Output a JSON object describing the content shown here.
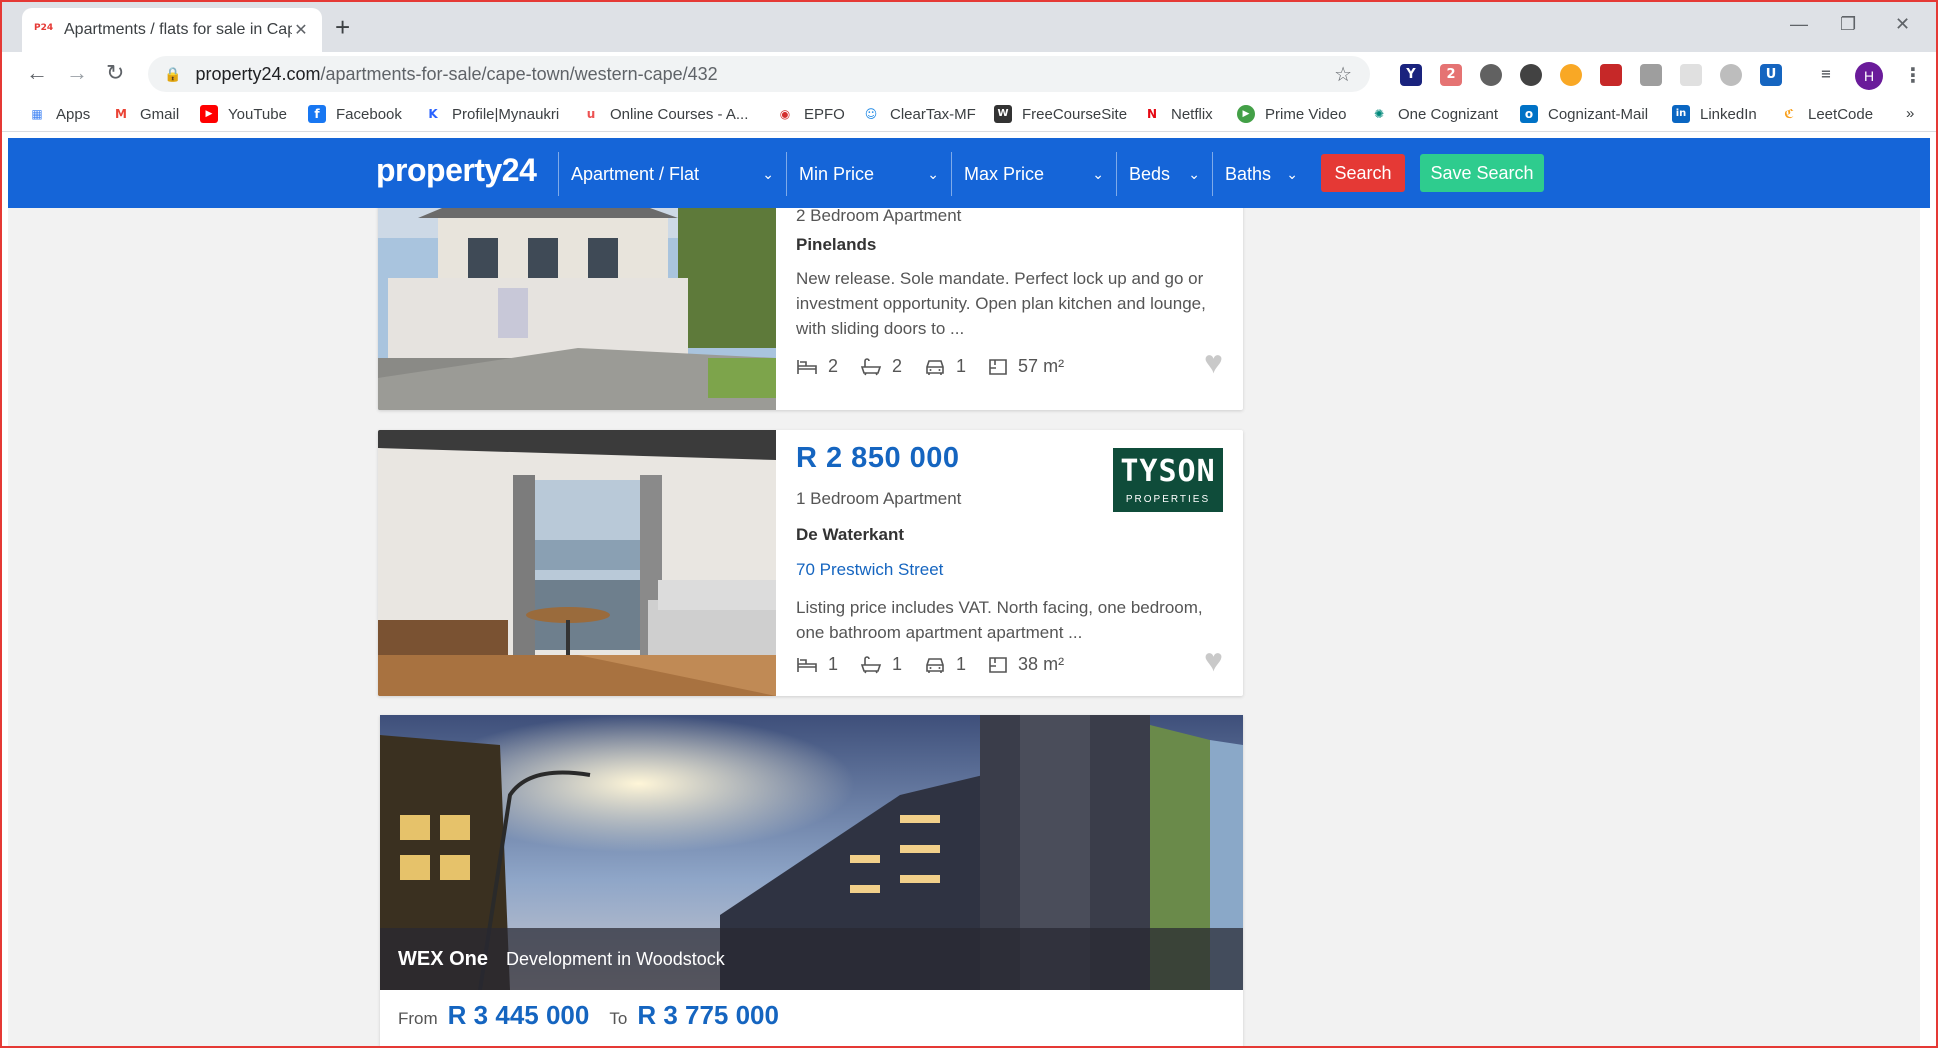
{
  "browser": {
    "tab_title": "Apartments / flats for sale in Cap",
    "favicon_text": "P24",
    "url_host": "property24.com",
    "url_path": "/apartments-for-sale/cape-town/western-cape/432",
    "profile_initial": "H",
    "extension_badge": "2"
  },
  "bookmarks": [
    {
      "label": "Apps",
      "icon": "apps-grid-icon",
      "color": "#4285f4"
    },
    {
      "label": "Gmail",
      "icon": "gmail-icon",
      "color": "#ea4335"
    },
    {
      "label": "YouTube",
      "icon": "youtube-icon",
      "color": "#ff0000"
    },
    {
      "label": "Facebook",
      "icon": "facebook-icon",
      "color": "#1877f2"
    },
    {
      "label": "Profile|Mynaukri",
      "icon": "naukri-icon",
      "color": "#2962ff"
    },
    {
      "label": "Online Courses - A...",
      "icon": "udemy-icon",
      "color": "#ec5252"
    },
    {
      "label": "EPFO",
      "icon": "epfo-icon",
      "color": "#d32f2f"
    },
    {
      "label": "ClearTax-MF",
      "icon": "cleartax-icon",
      "color": "#1e88e5"
    },
    {
      "label": "FreeCourseSite",
      "icon": "freecoursesite-icon",
      "color": "#333333"
    },
    {
      "label": "Netflix",
      "icon": "netflix-icon",
      "color": "#e50914"
    },
    {
      "label": "Prime Video",
      "icon": "prime-video-icon",
      "color": "#43a047"
    },
    {
      "label": "One Cognizant",
      "icon": "one-cognizant-icon",
      "color": "#00897b"
    },
    {
      "label": "Cognizant-Mail",
      "icon": "outlook-icon",
      "color": "#0072c6"
    },
    {
      "label": "LinkedIn",
      "icon": "linkedin-icon",
      "color": "#0a66c2"
    },
    {
      "label": "LeetCode",
      "icon": "leetcode-icon",
      "color": "#222222"
    }
  ],
  "header": {
    "logo": "property24",
    "filters": [
      "Apartment / Flat",
      "Min Price",
      "Max Price",
      "Beds",
      "Baths"
    ],
    "search_label": "Search",
    "save_search_label": "Save Search",
    "colors": {
      "brand": "#1565d8",
      "search": "#e53935",
      "save": "#2ecc8e"
    }
  },
  "listings": [
    {
      "type": "2 Bedroom Apartment",
      "suburb": "Pinelands",
      "description": "New release. Sole mandate. Perfect lock up and go or investment opportunity. Open plan kitchen and lounge, with sliding doors to ...",
      "beds": "2",
      "baths": "2",
      "parking": "1",
      "size": "57 m²"
    },
    {
      "price": "R 2 850 000",
      "type": "1 Bedroom Apartment",
      "suburb": "De Waterkant",
      "street": "70 Prestwich Street",
      "description": "Listing price includes VAT. North facing, one bedroom, one bathroom apartment apartment ...",
      "beds": "1",
      "baths": "1",
      "parking": "1",
      "size": "38 m²",
      "agency": {
        "name": "TYSON",
        "sub": "PROPERTIES"
      }
    }
  ],
  "development": {
    "name": "WEX One",
    "subtitle": "Development in Woodstock",
    "from_label": "From",
    "from_price": "R 3 445 000",
    "to_label": "To",
    "to_price": "R 3 775 000"
  }
}
